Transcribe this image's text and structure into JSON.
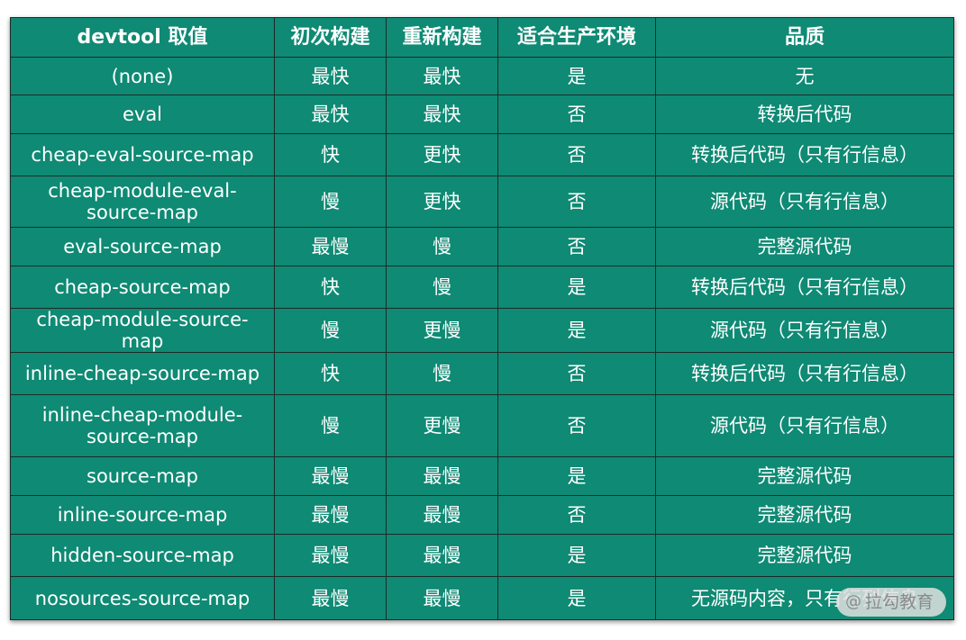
{
  "table": {
    "headers": [
      "devtool 取值",
      "初次构建",
      "重新构建",
      "适合生产环境",
      "品质"
    ],
    "rows": [
      [
        "(none)",
        "最快",
        "最快",
        "是",
        "无"
      ],
      [
        "eval",
        "最快",
        "最快",
        "否",
        "转换后代码"
      ],
      [
        "cheap-eval-source-map",
        "快",
        "更快",
        "否",
        "转换后代码（只有行信息）"
      ],
      [
        "cheap-module-eval-source-map",
        "慢",
        "更快",
        "否",
        "源代码（只有行信息）"
      ],
      [
        "eval-source-map",
        "最慢",
        "慢",
        "否",
        "完整源代码"
      ],
      [
        "cheap-source-map",
        "快",
        "慢",
        "是",
        "转换后代码（只有行信息）"
      ],
      [
        "cheap-module-source-map",
        "慢",
        "更慢",
        "是",
        "源代码（只有行信息）"
      ],
      [
        "inline-cheap-source-map",
        "快",
        "慢",
        "否",
        "转换后代码（只有行信息）"
      ],
      [
        "inline-cheap-module-source-map",
        "慢",
        "更慢",
        "否",
        "源代码（只有行信息）"
      ],
      [
        "source-map",
        "最慢",
        "最慢",
        "是",
        "完整源代码"
      ],
      [
        "inline-source-map",
        "最慢",
        "最慢",
        "否",
        "完整源代码"
      ],
      [
        "hidden-source-map",
        "最慢",
        "最慢",
        "是",
        "完整源代码"
      ],
      [
        "nosources-source-map",
        "最慢",
        "最慢",
        "是",
        "无源码内容，只有行列信息"
      ]
    ]
  },
  "watermark": {
    "at": "@",
    "text": "拉勾教育"
  }
}
